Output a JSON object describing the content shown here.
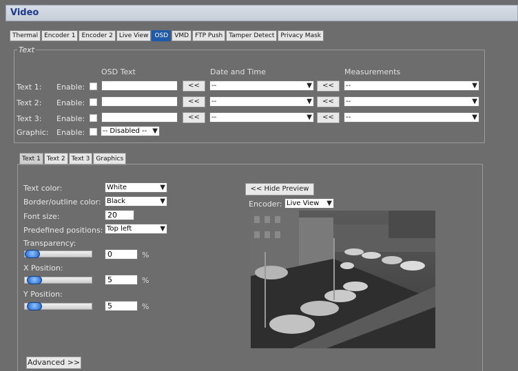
{
  "window": {
    "title": "Video"
  },
  "tabs": [
    "Thermal",
    "Encoder 1",
    "Encoder 2",
    "Live View",
    "OSD",
    "VMD",
    "FTP Push",
    "Tamper Detect",
    "Privacy Mask"
  ],
  "active_tab": "OSD",
  "text_section": {
    "legend": "Text",
    "columns": {
      "osd_text": "OSD Text",
      "date_time": "Date and Time",
      "measurements": "Measurements"
    },
    "rows": [
      {
        "label": "Text 1:",
        "enable_label": "Enable:",
        "enabled": false,
        "osd_text": "",
        "add_btn": "<<",
        "date_time": "--",
        "add_btn2": "<<",
        "measurement": "--"
      },
      {
        "label": "Text 2:",
        "enable_label": "Enable:",
        "enabled": false,
        "osd_text": "",
        "add_btn": "<<",
        "date_time": "--",
        "add_btn2": "<<",
        "measurement": "--"
      },
      {
        "label": "Text 3:",
        "enable_label": "Enable:",
        "enabled": false,
        "osd_text": "",
        "add_btn": "<<",
        "date_time": "--",
        "add_btn2": "<<",
        "measurement": "--"
      }
    ],
    "graphic": {
      "label": "Graphic:",
      "enable_label": "Enable:",
      "enabled": false,
      "value": "-- Disabled --"
    }
  },
  "sub_tabs": [
    "Text 1",
    "Text 2",
    "Text 3",
    "Graphics"
  ],
  "active_sub_tab": "Text 1",
  "settings": {
    "text_color": {
      "label": "Text color:",
      "value": "White"
    },
    "border_color": {
      "label": "Border/outline color:",
      "value": "Black"
    },
    "font_size": {
      "label": "Font size:",
      "value": "20"
    },
    "position": {
      "label": "Predefined positions:",
      "value": "Top left"
    },
    "transparency": {
      "label": "Transparency:",
      "value": "0",
      "unit": "%",
      "level": 0
    },
    "x_position": {
      "label": "X Position:",
      "value": "5",
      "unit": "%",
      "level": 5
    },
    "y_position": {
      "label": "Y Position:",
      "value": "5",
      "unit": "%",
      "level": 5
    }
  },
  "preview": {
    "hide_button": "<< Hide Preview",
    "encoder_label": "Encoder:",
    "encoder_value": "Live View"
  },
  "advanced_button": "Advanced >>"
}
